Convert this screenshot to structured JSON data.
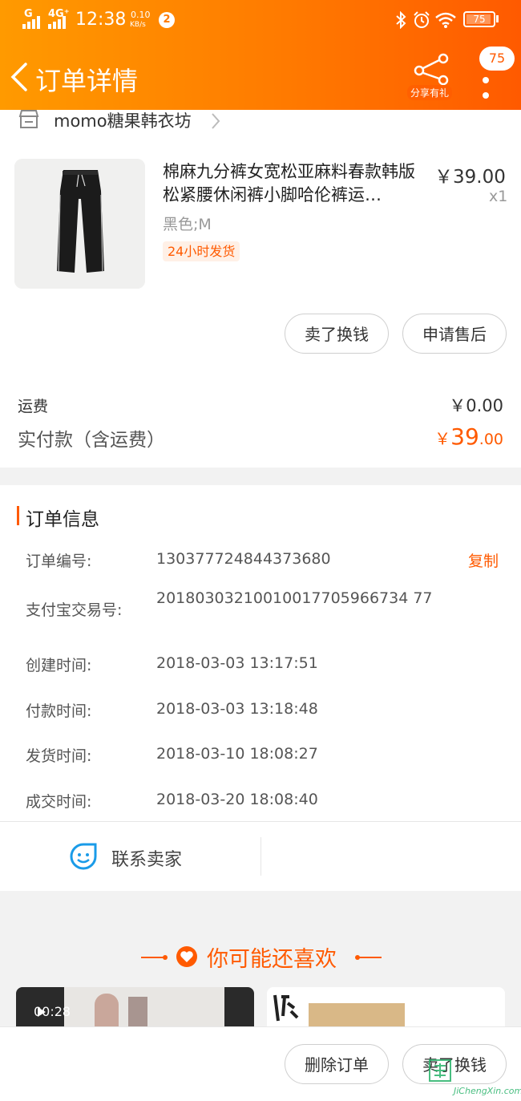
{
  "status_bar": {
    "network_1": "G",
    "network_2": "4G⁺",
    "time": "12:38",
    "speed_value": "0.10",
    "speed_unit": "KB/s",
    "notification_count": "2",
    "battery": "75"
  },
  "navbar": {
    "title": "订单详情",
    "share_label": "分享有礼",
    "badge_count": "75"
  },
  "shop": {
    "name": "momo糖果韩衣坊"
  },
  "product": {
    "title": "棉麻九分裤女宽松亚麻料春款韩版松紧腰休闲裤小脚哈伦裤运…",
    "price": "￥39.00",
    "quantity": "x1",
    "sku": "黑色;M",
    "tag": "24小时发货"
  },
  "item_actions": {
    "sell_label": "卖了换钱",
    "aftersale_label": "申请售后"
  },
  "summary": {
    "shipping_label": "运费",
    "shipping_value": "￥0.00",
    "total_label": "实付款（含运费）",
    "total_symbol": "￥",
    "total_int": "39",
    "total_dec": ".00"
  },
  "order_info": {
    "title": "订单信息",
    "copy_label": "复制",
    "rows": [
      {
        "label": "订单编号:",
        "value": "130377724844373680"
      },
      {
        "label": "支付宝交易号:",
        "value": "20180303210010017705966734 77"
      },
      {
        "label": "创建时间:",
        "value": "2018-03-03 13:17:51"
      },
      {
        "label": "付款时间:",
        "value": "2018-03-03 13:18:48"
      },
      {
        "label": "发货时间:",
        "value": "2018-03-10 18:08:27"
      },
      {
        "label": "成交时间:",
        "value": "2018-03-20 18:08:40"
      }
    ]
  },
  "contact": {
    "label": "联系卖家"
  },
  "recommend": {
    "title": "你可能还喜欢",
    "video_time": "00:28"
  },
  "bottom_bar": {
    "delete_label": "删除订单",
    "sell_label": "卖了换钱"
  },
  "watermark": {
    "text": "JiChengXin.com"
  },
  "colors": {
    "accent": "#ff5a00",
    "header_start": "#ff9a00",
    "header_end": "#ff5a00"
  }
}
